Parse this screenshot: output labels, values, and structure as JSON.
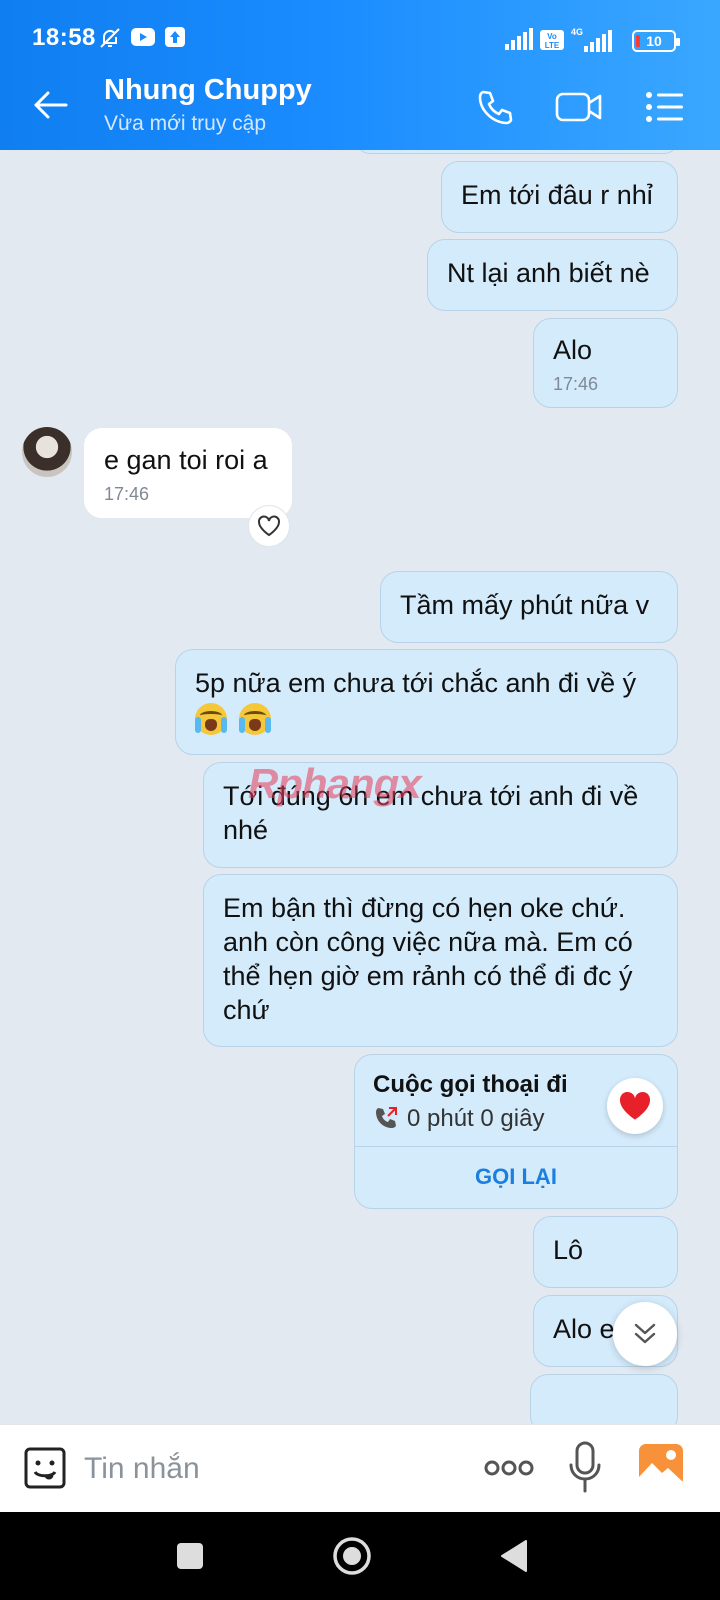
{
  "status_bar": {
    "time": "18:58",
    "battery": "10",
    "icons": [
      "bell-off-icon",
      "youtube-icon",
      "upload-icon",
      "signal-icon",
      "volte-icon",
      "4g-signal-icon",
      "battery-icon"
    ]
  },
  "header": {
    "contact_name": "Nhung Chuppy",
    "contact_status": "Vừa mới truy cập",
    "icons": [
      "back-arrow-icon",
      "phone-icon",
      "video-call-icon",
      "menu-list-icon"
    ]
  },
  "messages": [
    {
      "from": "me",
      "text": "Em tới đâu r nhỉ"
    },
    {
      "from": "me",
      "text": "Nt lại anh biết nè"
    },
    {
      "from": "me",
      "text": "Alo",
      "time": "17:46"
    },
    {
      "from": "them",
      "text": "e gan toi roi a",
      "time": "17:46"
    },
    {
      "from": "me",
      "text": "Tầm mấy phút nữa v"
    },
    {
      "from": "me",
      "text": "5p nữa em chưa tới chắc anh đi về ý"
    },
    {
      "from": "me",
      "text": "Tới đúng 6h em chưa tới anh đi về nhé"
    },
    {
      "from": "me",
      "text": "Em bận thì đừng có hẹn oke chứ. anh còn công việc nữa mà. Em có thể hẹn giờ em rảnh có thể đi đc ý chứ"
    },
    {
      "from": "me",
      "text": "Lô"
    },
    {
      "from": "me",
      "text": "Alo e"
    }
  ],
  "call_card": {
    "title": "Cuộc gọi thoại đi",
    "duration": "0 phút 0 giây",
    "action": "GỌI LẠI"
  },
  "watermark": "Rphangx",
  "input": {
    "placeholder": "Tin nhắn",
    "value": ""
  },
  "colors": {
    "header_blue": "#1a8cff",
    "my_bubble": "#d4ebfb",
    "chat_bg": "#e2e9f1",
    "link_blue": "#1a7fe0",
    "heart_red": "#e8202a"
  }
}
